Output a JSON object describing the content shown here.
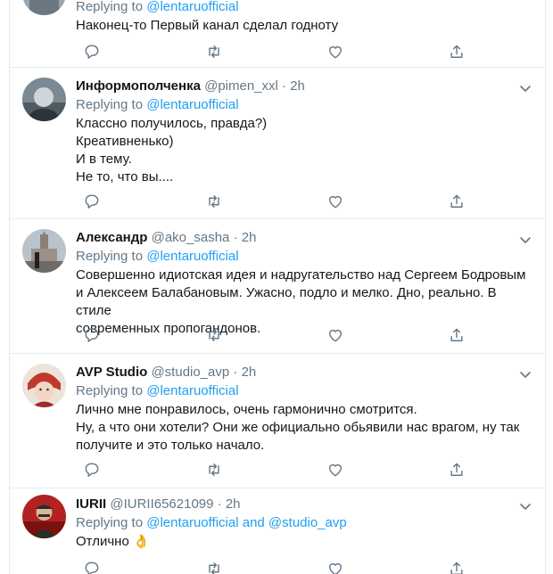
{
  "tweets": [
    {
      "name": "",
      "handle": "",
      "time": "",
      "replying_label": "Replying to",
      "replying_to": "@lentaruofficial",
      "text": "Наконец-то Первый канал сделал годноту"
    },
    {
      "name": "Информополченка",
      "handle": "@pimen_xxl",
      "time": "2h",
      "replying_label": "Replying to",
      "replying_to": "@lentaruofficial",
      "text": "Классно получилось, правда?)\nКреативненько)\nИ в тему.\nНе то, что вы...."
    },
    {
      "name": "Александр",
      "handle": "@ako_sasha",
      "time": "2h",
      "replying_label": "Replying to",
      "replying_to": "@lentaruofficial",
      "text": "Совершенно идиотская идея и надругательство над Сергеем Бодровым\nи Алексеем Балабановым. Ужасно, подло и мелко. Дно, реально. В стиле\nсовременных пропогандонов."
    },
    {
      "name": "AVP Studio",
      "handle": "@studio_avp",
      "time": "2h",
      "replying_label": "Replying to",
      "replying_to": "@lentaruofficial",
      "text": "Лично мне понравилось, очень гармонично смотрится.\nНу, а что они хотели? Они же официально обьявили нас врагом, ну так\nполучите и это только начало."
    },
    {
      "name": "IURII",
      "handle": "@IURII65621099",
      "time": "2h",
      "replying_label": "Replying to",
      "replying_to": "@lentaruofficial and @studio_avp",
      "text": "Отлично 👌"
    }
  ],
  "separator": "·",
  "icons": {
    "reply": "reply-icon",
    "retweet": "retweet-icon",
    "like": "like-icon",
    "share": "share-icon",
    "more": "chevron-down-icon"
  },
  "colors": {
    "link": "#1da1f2",
    "muted": "#657786",
    "text": "#14171a",
    "border": "#e6ecf0"
  }
}
